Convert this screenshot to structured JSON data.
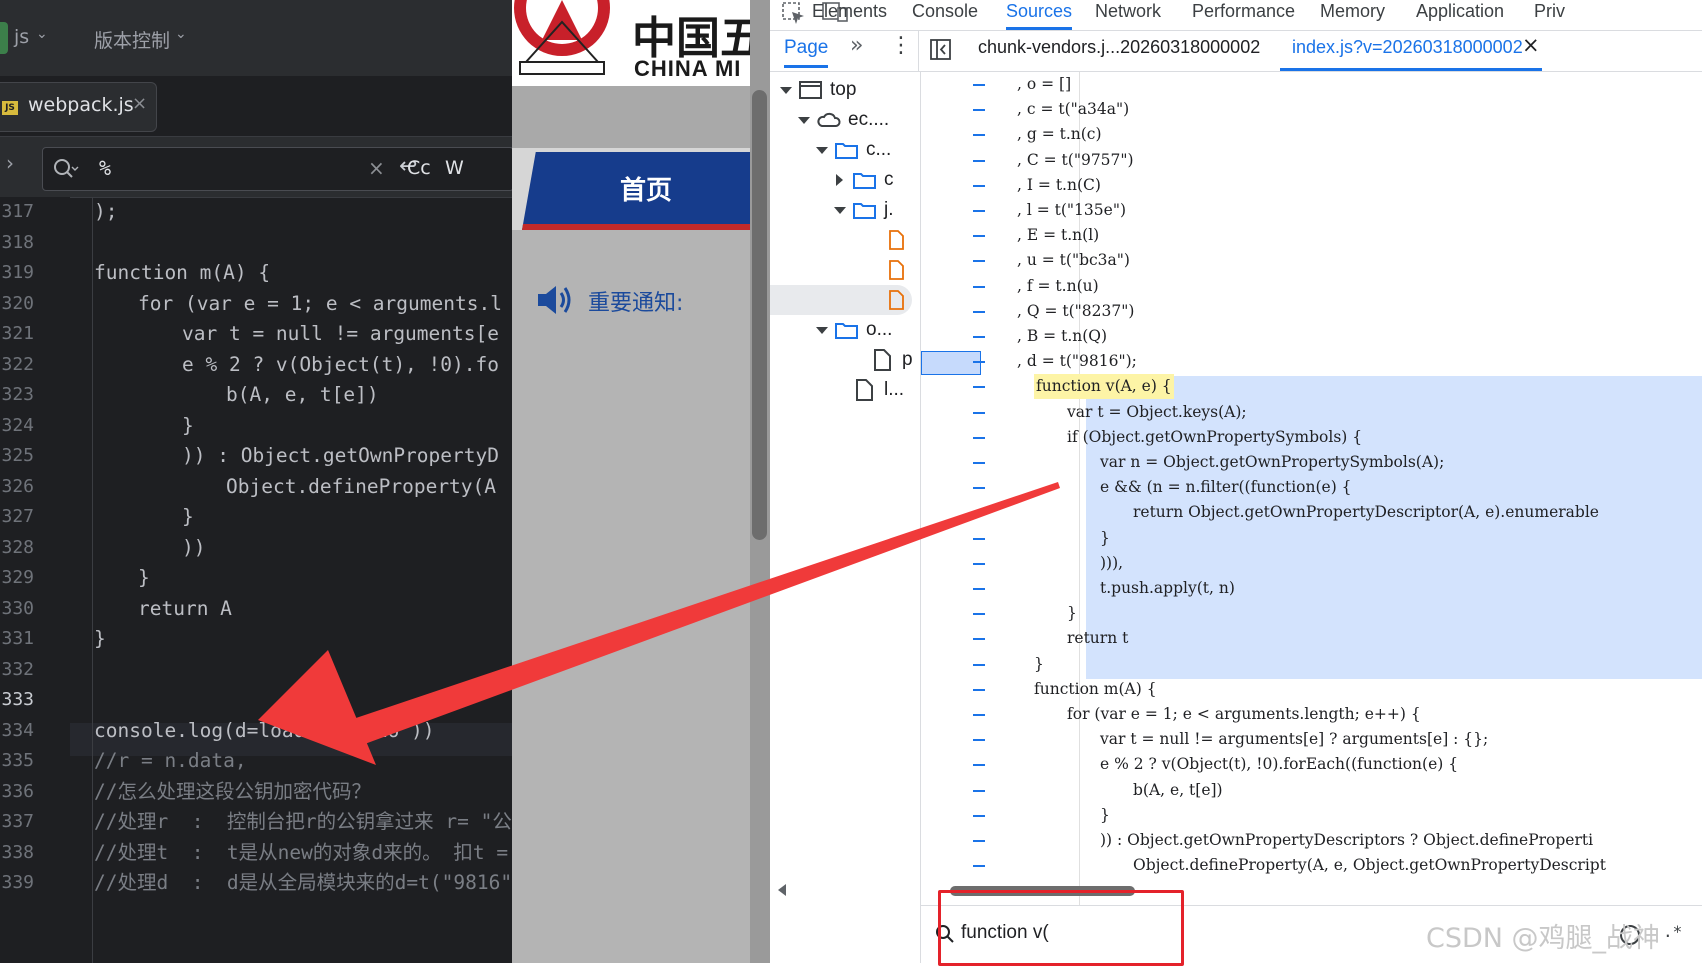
{
  "ide": {
    "menu": [
      "js",
      "版本控制"
    ],
    "file_tab": {
      "badge": "JS",
      "name": "webpack.js"
    },
    "search": {
      "query": "%",
      "case_label": "Cc",
      "word_label": "W"
    },
    "line_numbers": [
      "317",
      "318",
      "319",
      "320",
      "321",
      "322",
      "323",
      "324",
      "325",
      "326",
      "327",
      "328",
      "329",
      "330",
      "331",
      "332",
      "333",
      "334",
      "335",
      "336",
      "337",
      "338",
      "339"
    ],
    "lines": [
      ");",
      "",
      "function m(A) {",
      "for (var e = 1; e < arguments.l",
      "var t = null != arguments[e",
      "e % 2 ? v(Object(t), !0).fo",
      "b(A, e, t[e])",
      "}",
      ")) : Object.getOwnPropertyD",
      "Object.defineProperty(A",
      "}",
      "))",
      "}",
      "return A",
      "}",
      "",
      "",
      "console.log(d=loader(\"9816\"))",
      "//r = n.data,",
      "//怎么处理这段公钥加密代码？",
      "//处理r  :  控制台把r的公钥拿过来 r= \"公",
      "//处理t  :  t是从new的对象d来的。 扣t =",
      "//处理d  :  d是从全局模块来的d=t(\"9816\""
    ]
  },
  "web": {
    "logo_cn": "中国五",
    "logo_en": "CHINA MI",
    "nav_home": "首页",
    "notice_label": "重要通知:"
  },
  "devtools": {
    "tabs": [
      "Elements",
      "Console",
      "Sources",
      "Network",
      "Performance",
      "Memory",
      "Application",
      "Priv"
    ],
    "active_tab": "Sources",
    "page_tab": "Page",
    "file_tabs": [
      "chunk-vendors.j...20260318000002",
      "index.js?v=20260318000002"
    ],
    "tree": [
      "top",
      "ec....",
      "c...",
      "c",
      "j.",
      "o...",
      "p",
      "l..."
    ],
    "code_lines": [
      ", o = []",
      ", c = t(\"a34a\")",
      ", g = t.n(c)",
      ", C = t(\"9757\")",
      ", I = t.n(C)",
      ", l = t(\"135e\")",
      ", E = t.n(l)",
      ", u = t(\"bc3a\")",
      ", f = t.n(u)",
      ", Q = t(\"8237\")",
      ", B = t.n(Q)",
      ", d = t(\"9816\");",
      "function v(A, e) {",
      "var t = Object.keys(A);",
      "if (Object.getOwnPropertySymbols) {",
      "var n = Object.getOwnPropertySymbols(A);",
      "e && (n = n.filter((function(e) {",
      "return Object.getOwnPropertyDescriptor(A, e).enumerable",
      "}",
      "))),",
      "t.push.apply(t, n)",
      "}",
      "return t",
      "}",
      "function m(A) {",
      "for (var e = 1; e < arguments.length; e++) {",
      "var t = null != arguments[e] ? arguments[e] : {};",
      "e % 2 ? v(Object(t), !0).forEach((function(e) {",
      "b(A, e, t[e])",
      "}",
      ")) : Object.getOwnPropertyDescriptors ? Object.defineProperti",
      "Object.defineProperty(A, e, Object.getOwnPropertyDescript"
    ],
    "search_query": "function v(",
    "search_options": ".*"
  },
  "watermark": "CSDN @鸡腿_战神",
  "colors": {
    "accent": "#1a73e8",
    "annotation_red": "#e4222a",
    "nav_blue": "#163c8c"
  }
}
